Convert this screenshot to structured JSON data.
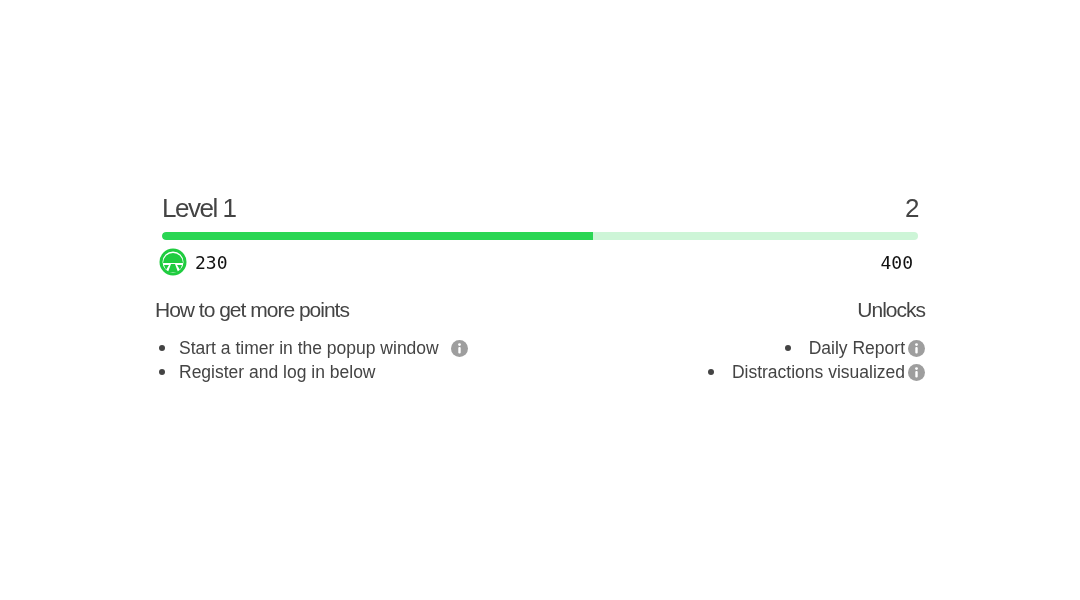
{
  "level": {
    "current": "Level 1",
    "next": "2"
  },
  "progress": {
    "level": 0.57
  },
  "points": {
    "current": "230",
    "target": "400"
  },
  "how_to": {
    "title": "How to get more points",
    "items": [
      {
        "text": "Start a timer in the popup window",
        "info": true
      },
      {
        "text": "Register and log in below",
        "info": false
      }
    ]
  },
  "unlocks": {
    "title": "Unlocks",
    "items": [
      {
        "text": "Daily Report",
        "info": true
      },
      {
        "text": "Distractions visualized",
        "info": true
      }
    ]
  }
}
